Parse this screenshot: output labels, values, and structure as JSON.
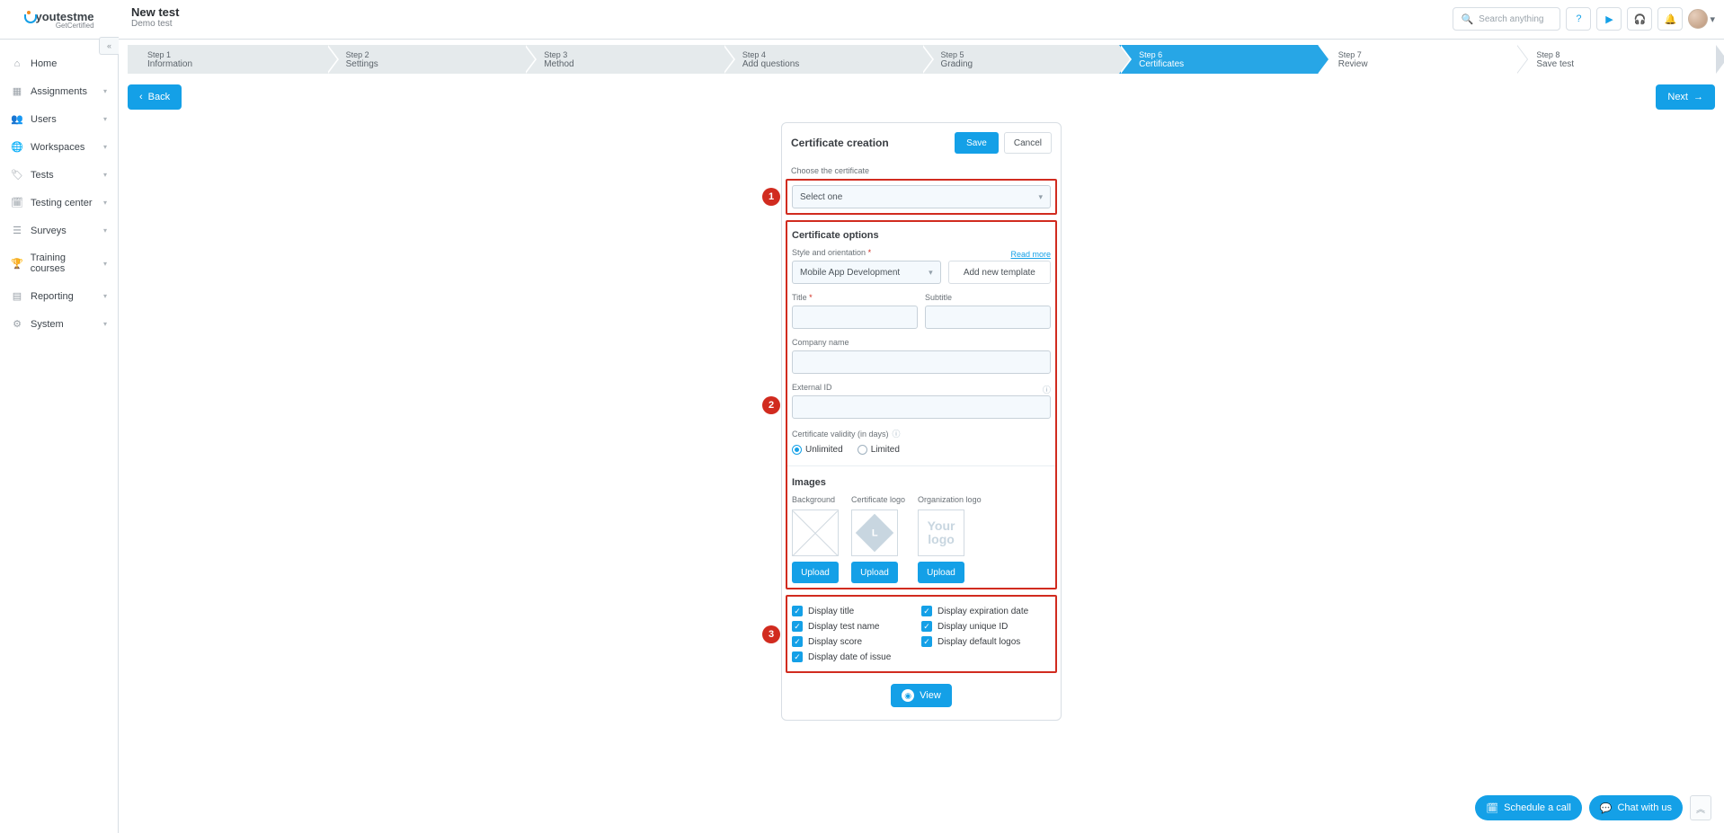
{
  "brand": {
    "name_a": "you",
    "name_b": "test",
    "name_c": "me",
    "sub": "GetCertified"
  },
  "page": {
    "title": "New test",
    "subtitle": "Demo test"
  },
  "search": {
    "placeholder": "Search anything"
  },
  "sidebar": {
    "items": [
      {
        "label": "Home",
        "icon": "home-icon",
        "glyph": "⌂",
        "expandable": false
      },
      {
        "label": "Assignments",
        "icon": "assignments-icon",
        "glyph": "▦",
        "expandable": true
      },
      {
        "label": "Users",
        "icon": "users-icon",
        "glyph": "👥",
        "expandable": true
      },
      {
        "label": "Workspaces",
        "icon": "workspaces-icon",
        "glyph": "🌐",
        "expandable": true
      },
      {
        "label": "Tests",
        "icon": "tests-icon",
        "glyph": "🏷",
        "expandable": true
      },
      {
        "label": "Testing center",
        "icon": "testing-center-icon",
        "glyph": "🗓",
        "expandable": true
      },
      {
        "label": "Surveys",
        "icon": "surveys-icon",
        "glyph": "☰",
        "expandable": true
      },
      {
        "label": "Training courses",
        "icon": "training-icon",
        "glyph": "🏆",
        "expandable": true
      },
      {
        "label": "Reporting",
        "icon": "reporting-icon",
        "glyph": "▤",
        "expandable": true
      },
      {
        "label": "System",
        "icon": "system-icon",
        "glyph": "⚙",
        "expandable": true
      }
    ]
  },
  "steps": [
    {
      "n": "Step 1",
      "t": "Information",
      "cls": ""
    },
    {
      "n": "Step 2",
      "t": "Settings",
      "cls": ""
    },
    {
      "n": "Step 3",
      "t": "Method",
      "cls": ""
    },
    {
      "n": "Step 4",
      "t": "Add questions",
      "cls": ""
    },
    {
      "n": "Step 5",
      "t": "Grading",
      "cls": ""
    },
    {
      "n": "Step 6",
      "t": "Certificates",
      "cls": "current"
    },
    {
      "n": "Step 7",
      "t": "Review",
      "cls": "plain first"
    },
    {
      "n": "Step 8",
      "t": "Save test",
      "cls": "plain nochevr"
    }
  ],
  "buttons": {
    "back": "Back",
    "next": "Next",
    "save": "Save",
    "cancel": "Cancel",
    "upload": "Upload",
    "view": "View",
    "addTemplate": "Add new template",
    "readMore": "Read more",
    "schedule": "Schedule a call",
    "chat": "Chat with us"
  },
  "card": {
    "title": "Certificate creation",
    "chooseLabel": "Choose the certificate",
    "choosePlaceholder": "Select one",
    "optionsTitle": "Certificate options",
    "styleLabel": "Style and orientation",
    "styleValue": "Mobile App Development",
    "titleLabel": "Title",
    "subtitleLabel": "Subtitle",
    "companyLabel": "Company name",
    "externalLabel": "External ID",
    "validityLabel": "Certificate validity (in days)",
    "validity": {
      "unlimited": "Unlimited",
      "limited": "Limited"
    },
    "imagesTitle": "Images",
    "img": {
      "bg": "Background",
      "cert": "Certificate logo",
      "org": "Organization logo",
      "orgText": "Your logo"
    },
    "disp": {
      "title": "Display title",
      "test": "Display test name",
      "score": "Display score",
      "issue": "Display date of issue",
      "exp": "Display expiration date",
      "uid": "Display unique ID",
      "logos": "Display default logos"
    }
  },
  "annot": {
    "one": "1",
    "two": "2",
    "three": "3"
  }
}
